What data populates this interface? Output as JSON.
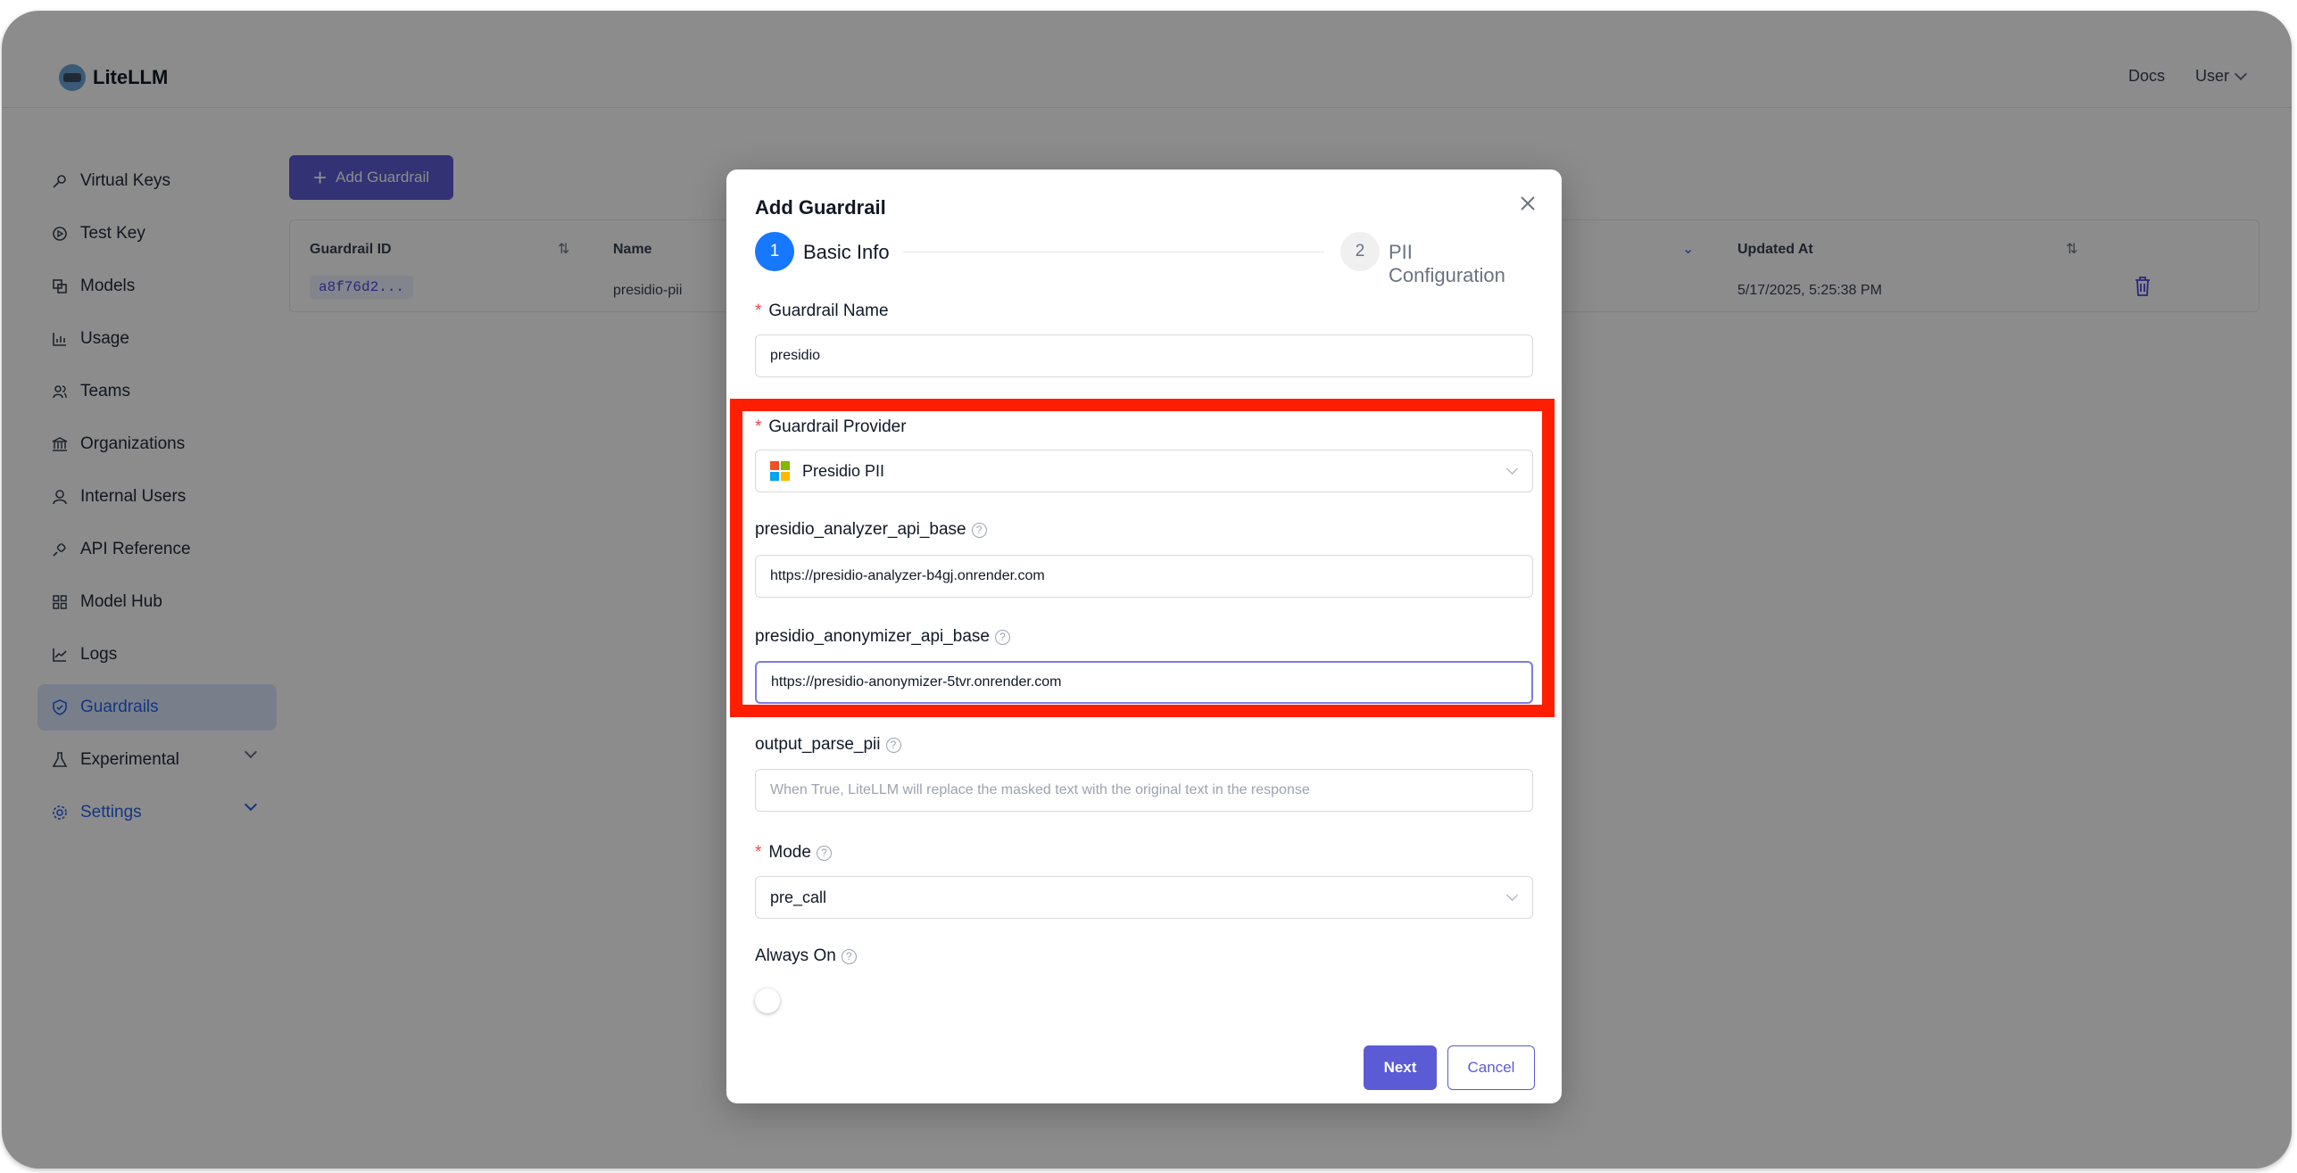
{
  "app": {
    "name": "LiteLLM",
    "header_links": {
      "docs": "Docs",
      "user": "User"
    }
  },
  "sidebar": {
    "items": [
      {
        "label": "Virtual Keys",
        "icon": "key-icon"
      },
      {
        "label": "Test Key",
        "icon": "play-circle-icon"
      },
      {
        "label": "Models",
        "icon": "copy-icon"
      },
      {
        "label": "Usage",
        "icon": "bar-chart-icon"
      },
      {
        "label": "Teams",
        "icon": "team-icon"
      },
      {
        "label": "Organizations",
        "icon": "bank-icon"
      },
      {
        "label": "Internal Users",
        "icon": "user-icon"
      },
      {
        "label": "API Reference",
        "icon": "api-icon"
      },
      {
        "label": "Model Hub",
        "icon": "appstore-icon"
      },
      {
        "label": "Logs",
        "icon": "line-chart-icon"
      },
      {
        "label": "Guardrails",
        "icon": "safety-icon"
      },
      {
        "label": "Experimental",
        "icon": "experiment-icon"
      },
      {
        "label": "Settings",
        "icon": "setting-icon"
      }
    ]
  },
  "main": {
    "add_button": "Add Guardrail",
    "table": {
      "headers": {
        "id": "Guardrail ID",
        "name": "Name",
        "updated": "Updated At"
      },
      "rows": [
        {
          "id": "a8f76d2...",
          "name": "presidio-pii",
          "updated": "5/17/2025, 5:25:38 PM"
        }
      ]
    }
  },
  "modal": {
    "title": "Add Guardrail",
    "steps": [
      {
        "number": "1",
        "label": "Basic Info"
      },
      {
        "number": "2",
        "label": "PII Configuration"
      }
    ],
    "fields": {
      "name": {
        "label": "Guardrail Name",
        "value": "presidio"
      },
      "provider": {
        "label": "Guardrail Provider",
        "value": "Presidio PII"
      },
      "analyzer": {
        "label": "presidio_analyzer_api_base",
        "value": "https://presidio-analyzer-b4gj.onrender.com"
      },
      "anonymizer": {
        "label": "presidio_anonymizer_api_base",
        "value": "https://presidio-anonymizer-5tvr.onrender.com"
      },
      "output_parse": {
        "label": "output_parse_pii",
        "placeholder": "When True, LiteLLM will replace the masked text with the original text in the response"
      },
      "mode": {
        "label": "Mode",
        "value": "pre_call"
      },
      "always_on": {
        "label": "Always On",
        "enabled": false
      }
    },
    "buttons": {
      "next": "Next",
      "cancel": "Cancel"
    }
  },
  "colors": {
    "primary": "#5b5bd6",
    "step_active": "#1677ff",
    "highlight": "#ff1e00",
    "active_nav": "#2563eb"
  }
}
